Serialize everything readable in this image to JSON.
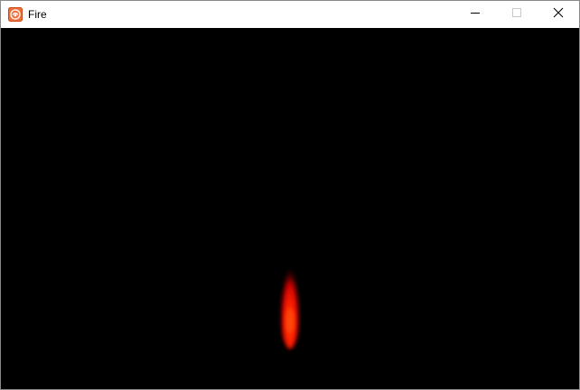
{
  "window": {
    "title": "Fire",
    "app_icon": "fire-app-icon",
    "controls": {
      "minimize_icon": "minimize-icon",
      "maximize_icon": "maximize-icon",
      "close_icon": "close-icon"
    }
  },
  "canvas": {
    "background_color": "#000000",
    "flame": {
      "core_color": "#ff3a00",
      "inner_color": "#ff1e00",
      "edge_color": "#b40000"
    }
  }
}
